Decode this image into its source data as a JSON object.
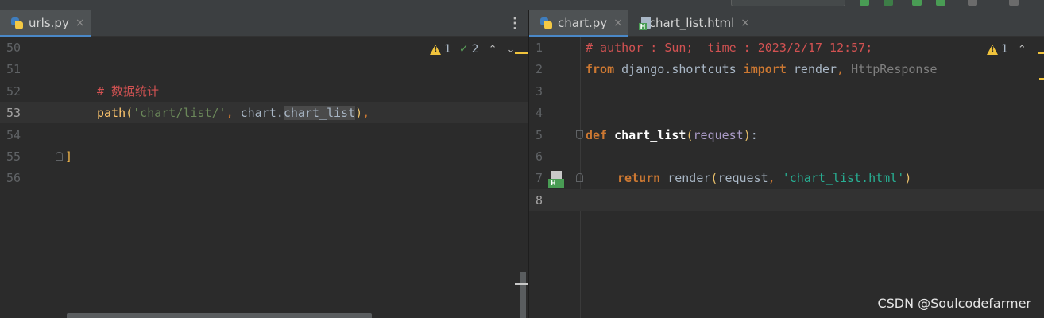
{
  "left_editor": {
    "tab": {
      "label": "urls.py",
      "close": "×"
    },
    "inspection": {
      "warnings": "1",
      "typos": "2"
    },
    "lines": [
      {
        "n": "50"
      },
      {
        "n": "51"
      },
      {
        "n": "52",
        "comment": "# 数据统计"
      },
      {
        "n": "53",
        "path": "path",
        "open": "(",
        "str": "'chart/list/'",
        "comma": ",",
        "obj": " chart.",
        "func": "chart_list",
        "close": ")",
        "tail": ","
      },
      {
        "n": "54"
      },
      {
        "n": "55",
        "bracket": "]"
      },
      {
        "n": "56"
      }
    ]
  },
  "right_editor": {
    "tabs": [
      {
        "label": "chart.py",
        "close": "×"
      },
      {
        "label": "chart_list.html",
        "close": "×"
      }
    ],
    "inspection": {
      "warnings": "1"
    },
    "lines": [
      {
        "n": "1",
        "comment": "# author : Sun;  time : 2023/2/17 12:57;"
      },
      {
        "n": "2",
        "kw_from": "from",
        "module": " django.shortcuts ",
        "kw_import": "import",
        "name1": " render",
        "comma": ",",
        "name2": " HttpResponse"
      },
      {
        "n": "3"
      },
      {
        "n": "4"
      },
      {
        "n": "5",
        "kw_def": "def",
        "fname": " chart_list",
        "open": "(",
        "param": "request",
        "close": ")",
        "colon": ":"
      },
      {
        "n": "6"
      },
      {
        "n": "7",
        "kw_return": "return",
        "call": " render",
        "open": "(",
        "arg": "request",
        "comma": ",",
        "str": " 'chart_list.html'",
        "close": ")"
      },
      {
        "n": "8"
      }
    ]
  },
  "watermark": "CSDN @Soulcodefarmer"
}
